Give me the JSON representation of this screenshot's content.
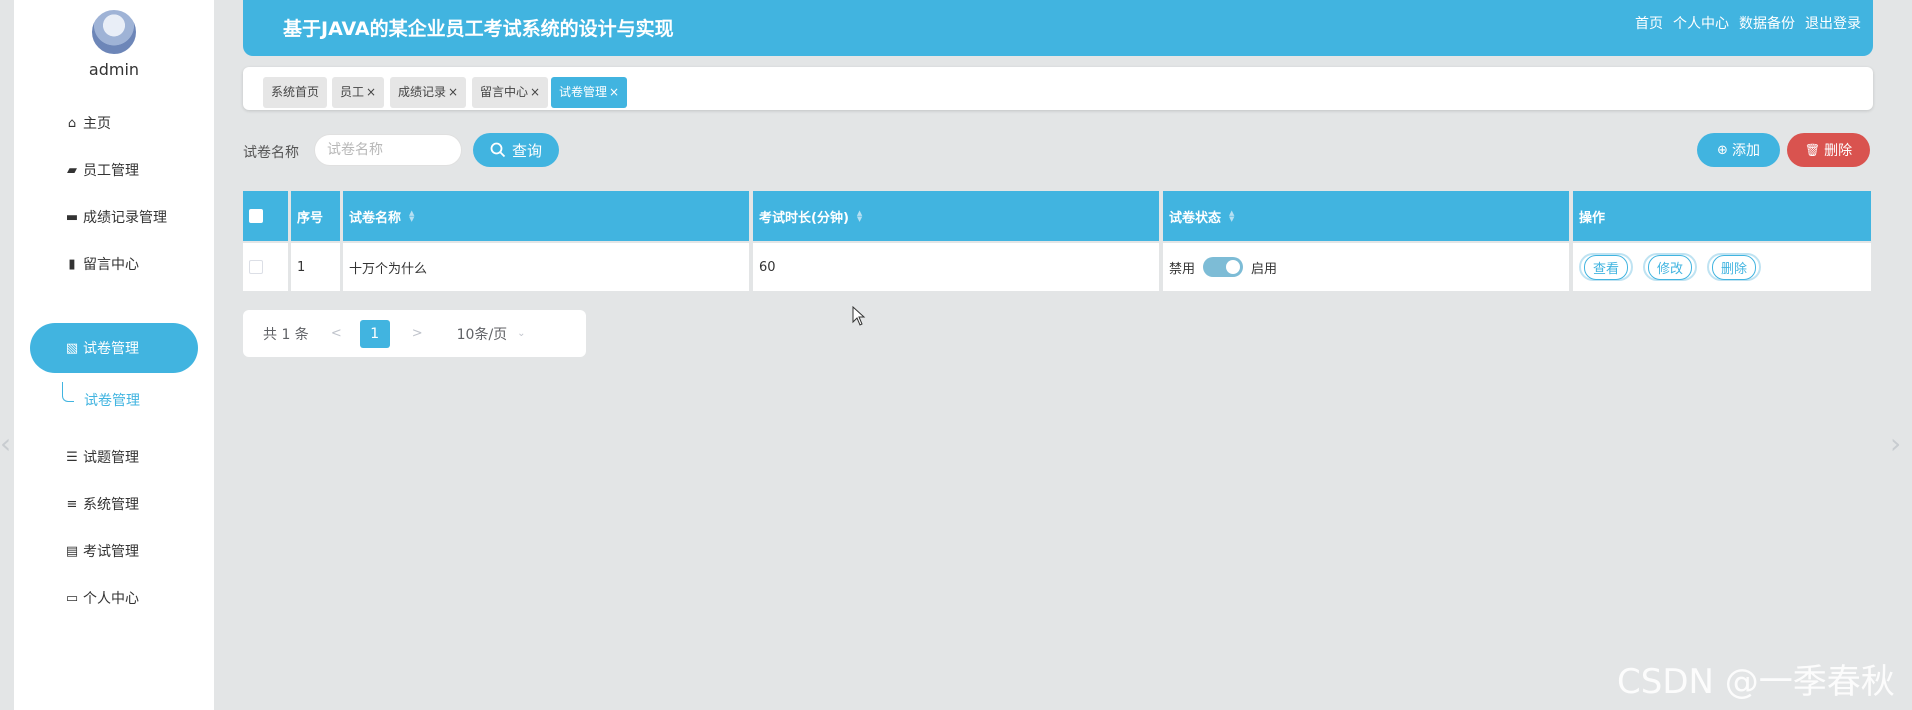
{
  "user": {
    "name": "admin"
  },
  "sidebar": {
    "items": [
      {
        "label": "主页",
        "icon": "home-icon"
      },
      {
        "label": "员工管理",
        "icon": "user-icon"
      },
      {
        "label": "成绩记录管理",
        "icon": "monitor-icon"
      },
      {
        "label": "留言中心",
        "icon": "bar-chart-icon"
      },
      {
        "label": "试卷管理",
        "icon": "document-icon"
      },
      {
        "label": "试题管理",
        "icon": "list-icon"
      },
      {
        "label": "系统管理",
        "icon": "menu-icon"
      },
      {
        "label": "考试管理",
        "icon": "briefcase-icon"
      },
      {
        "label": "个人中心",
        "icon": "card-icon"
      }
    ],
    "active_sub": "试卷管理"
  },
  "header": {
    "title": "基于JAVA的某企业员工考试系统的设计与实现",
    "links": [
      "首页",
      "个人中心",
      "数据备份",
      "退出登录"
    ]
  },
  "tags": [
    {
      "label": "系统首页",
      "closable": false
    },
    {
      "label": "员工",
      "closable": true
    },
    {
      "label": "成绩记录",
      "closable": true
    },
    {
      "label": "留言中心",
      "closable": true
    },
    {
      "label": "试卷管理",
      "closable": true,
      "active": true
    }
  ],
  "search": {
    "label": "试卷名称",
    "placeholder": "试卷名称",
    "query_label": "查询",
    "add_label": "添加",
    "delete_label": "删除"
  },
  "table": {
    "columns": [
      "序号",
      "试卷名称",
      "考试时长(分钟)",
      "试卷状态",
      "操作"
    ],
    "rows": [
      {
        "index": "1",
        "name": "十万个为什么",
        "duration": "60",
        "status_off": "禁用",
        "status_on": "启用",
        "enabled": true
      }
    ],
    "actions": [
      "查看",
      "修改",
      "删除"
    ]
  },
  "pagination": {
    "total": "共 1 条",
    "prev": "<",
    "page": "1",
    "next": ">",
    "size": "10条/页"
  },
  "watermark": "CSDN @一季春秋",
  "colors": {
    "accent": "#41b4e0",
    "danger": "#d9534f",
    "background": "#e3e5e6"
  }
}
